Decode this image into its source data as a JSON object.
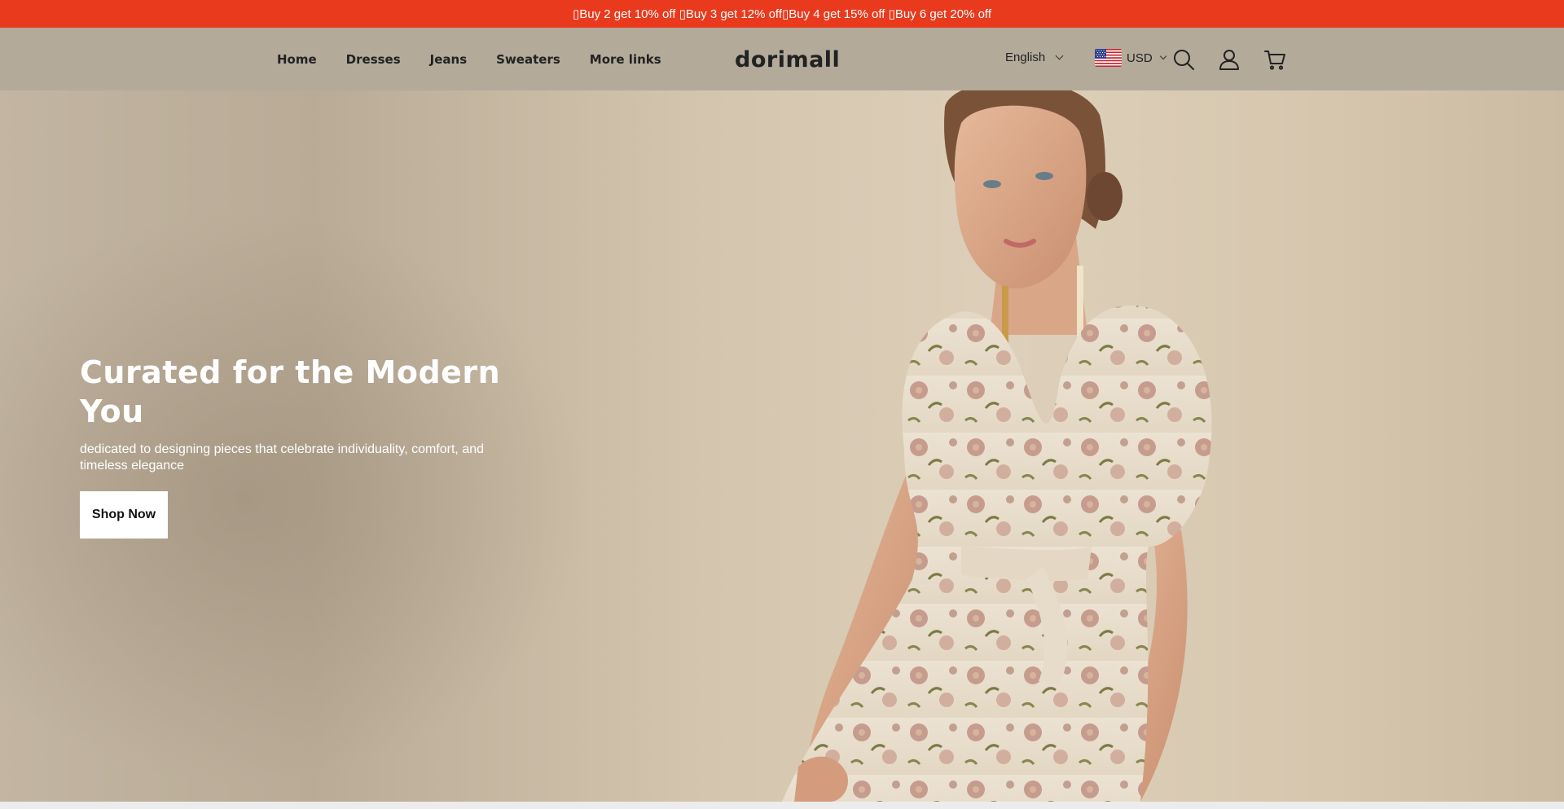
{
  "announcement": {
    "items": [
      "Buy 2 get 10% off",
      "Buy 3 get 12% off",
      "Buy 4 get 15% off",
      "Buy 6 get 20% off"
    ],
    "separator_glyph": "▯"
  },
  "header": {
    "nav": [
      "Home",
      "Dresses",
      "Jeans",
      "Sweaters",
      "More links"
    ],
    "logo": "dorimall",
    "language": "English",
    "currency": "USD",
    "icons": [
      "search-icon",
      "account-icon",
      "cart-icon"
    ]
  },
  "hero": {
    "title": "Curated for the Modern You",
    "subtitle": "dedicated to designing pieces that celebrate individuality, comfort, and timeless elegance",
    "button": "Shop Now"
  },
  "colors": {
    "announcement_bg": "#e93a1d",
    "header_bg": "#b3aa9a",
    "hero_bg": "#d4c5ae"
  }
}
